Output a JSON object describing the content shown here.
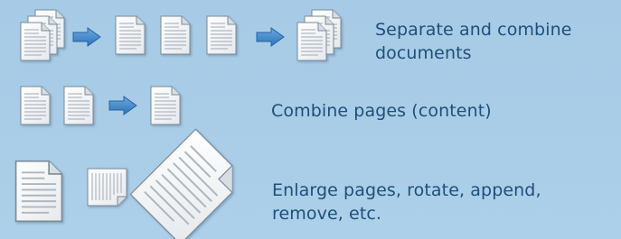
{
  "rows": [
    {
      "caption": "Separate and combine documents",
      "icons": [
        "document-stack-icon",
        "arrow-right-icon",
        "document-icon",
        "document-icon",
        "document-icon",
        "arrow-right-icon",
        "document-stack-icon"
      ]
    },
    {
      "caption": "Combine pages (content)",
      "icons": [
        "document-icon",
        "document-icon",
        "arrow-right-icon",
        "document-icon"
      ]
    },
    {
      "caption": "Enlarge pages, rotate, append, remove, etc.",
      "icons": [
        "document-icon",
        "document-landscape-icon",
        "document-rotated-icon"
      ]
    }
  ],
  "colors": {
    "background": "#a9cde7",
    "caption": "#1f4f7a",
    "arrow": "#3f86c9",
    "page": "#f4f4f4",
    "page_border": "#7a8b99",
    "page_lines": "#b4bcc4"
  }
}
